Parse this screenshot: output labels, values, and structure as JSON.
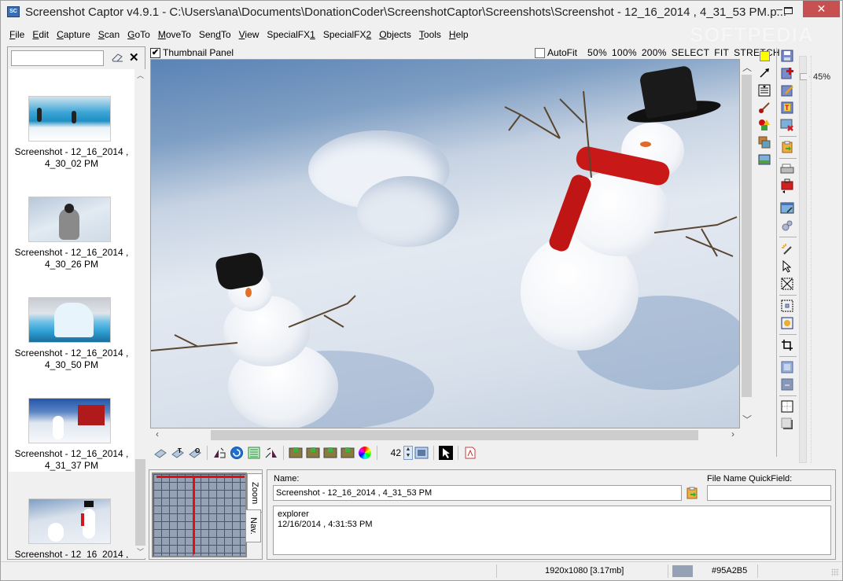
{
  "window": {
    "title": "Screenshot Captor v4.9.1 - C:\\Users\\ana\\Documents\\DonationCoder\\ScreenshotCaptor\\Screenshots\\Screenshot - 12_16_2014 , 4_31_53 PM.p...",
    "app_icon_label": "SC",
    "minimize": "–",
    "maximize": "☐",
    "close": "✕",
    "watermark": "SOFTPEDIA"
  },
  "menu": [
    {
      "label": "File",
      "accel": "F",
      "rest": "ile"
    },
    {
      "label": "Edit",
      "accel": "E",
      "rest": "dit"
    },
    {
      "label": "Capture",
      "accel": "C",
      "rest": "apture"
    },
    {
      "label": "Scan",
      "accel": "S",
      "rest": "can"
    },
    {
      "label": "GoTo",
      "accel": "G",
      "rest": "oTo"
    },
    {
      "label": "MoveTo",
      "accel": "M",
      "rest": "oveTo"
    },
    {
      "label": "SendTo",
      "pre": "Sen",
      "accel": "d",
      "rest": "To"
    },
    {
      "label": "View",
      "accel": "V",
      "rest": "iew"
    },
    {
      "label": "SpecialFX1",
      "pre": "SpecialFX",
      "accel": "1",
      "rest": ""
    },
    {
      "label": "SpecialFX2",
      "pre": "SpecialFX",
      "accel": "2",
      "rest": ""
    },
    {
      "label": "Objects",
      "accel": "O",
      "rest": "bjects"
    },
    {
      "label": "Tools",
      "accel": "T",
      "rest": "ools"
    },
    {
      "label": "Help",
      "accel": "H",
      "rest": "elp"
    }
  ],
  "left_panel": {
    "search_value": "",
    "clear_label": "✕",
    "thumbnails": [
      {
        "line1": "Screenshot - 12_16_2014 ,",
        "line2": "4_30_02 PM",
        "subject": "penguins on ice"
      },
      {
        "line1": "Screenshot - 12_16_2014 ,",
        "line2": "4_30_26 PM",
        "subject": "penguin chick"
      },
      {
        "line1": "Screenshot - 12_16_2014 ,",
        "line2": "4_30_50 PM",
        "subject": "iceberg"
      },
      {
        "line1": "Screenshot - 12_16_2014 ,",
        "line2": "4_31_37 PM",
        "subject": "snowman and red barn"
      },
      {
        "line1": "Screenshot - 12_16_2014 ,",
        "line2": "",
        "subject": "snowmen in snow",
        "selected": true
      }
    ]
  },
  "viewer": {
    "thumbnail_panel_label": "Thumbnail Panel",
    "thumbnail_panel_checked": "✔",
    "autofit_label": "AutoFit",
    "zoom_links": [
      "50%",
      "100%",
      "200%",
      "SELECT",
      "FIT",
      "STRETCH"
    ],
    "zoom_percent": "45%",
    "border_size": "42",
    "image_subject": "two snowmen with top hats in snow"
  },
  "colors": {
    "yellow_swatch": "#ffff00",
    "picked_color": "#95A2B5",
    "close_button": "#c75050",
    "nav_red": "#e01010"
  },
  "bottom": {
    "tabs": [
      "Zoom",
      "Nav."
    ],
    "name_label": "Name:",
    "name_value": "Screenshot - 12_16_2014 , 4_31_53 PM",
    "quickfield_label": "File Name QuickField:",
    "quickfield_value": "",
    "notes_line1": "explorer",
    "notes_line2": "12/16/2014 , 4:31:53 PM"
  },
  "status": {
    "dimensions": "1920x1080  [3.17mb]",
    "color_hex": "#95A2B5"
  }
}
